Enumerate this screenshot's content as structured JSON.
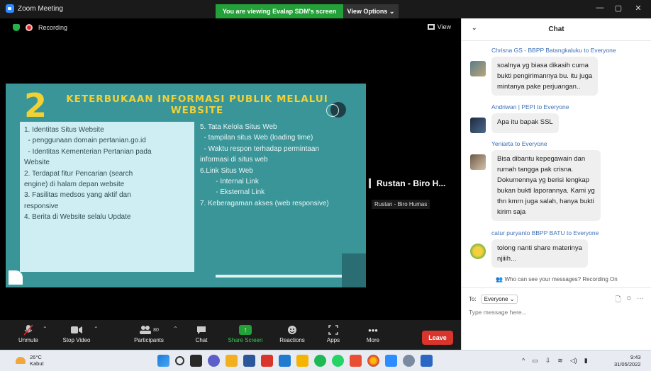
{
  "window": {
    "title": "Zoom Meeting",
    "viewing_banner": "You are viewing Evalap SDM's screen",
    "view_options": "View Options ⌄",
    "minimize": "—",
    "restore": "▢",
    "close": "✕"
  },
  "meeting": {
    "recording_label": "Recording",
    "view_label": "View",
    "speaker_name": "Rustan - Biro H...",
    "speaker_tag": "Rustan - Biro Humas"
  },
  "slide": {
    "number": "2",
    "title": "KETERBUKAAN INFORMASI PUBLIK MELALUI WEBSITE",
    "left_items": [
      "1. Identitas Situs Website",
      "  - penggunaan domain pertanian.go.id",
      "  - Identitas Kementerian Pertanian pada",
      "Website",
      "2. Terdapat fitur Pencarian (search",
      "engine) di halam depan website",
      "3. Fasilitas medsos yang aktif dan",
      "responsive",
      "4. Berita di Website selalu Update"
    ],
    "right_items": [
      "5. Tata Kelola Situs Web",
      "  - tampilan situs Web (loading time)",
      "  - Waktu respon terhadap permintaan",
      "informasi di situs web",
      "6.Link Situs Web",
      "        - Internal Link",
      "        - Eksternal Link",
      "7. Keberagaman akses (web responsive)"
    ]
  },
  "toolbar": {
    "unmute": "Unmute",
    "stop_video": "Stop Video",
    "participants": "Participants",
    "participants_count": "80",
    "chat": "Chat",
    "share_screen": "Share Screen",
    "reactions": "Reactions",
    "apps": "Apps",
    "more": "More",
    "leave": "Leave"
  },
  "chat": {
    "header": "Chat",
    "messages": [
      {
        "sender": "Chrisna GS - BBPP Batangkaluku to Everyone",
        "lines": [
          "soalnya yg biasa dikasih cuma",
          "bukti pengirimannya bu. itu juga",
          "mintanya pake perjuangan.."
        ]
      },
      {
        "sender": "Andriwan | PEPI to Everyone",
        "lines": [
          "Apa itu bapak SSL"
        ]
      },
      {
        "sender": "Yeniarta to Everyone",
        "lines": [
          "Bisa dibantu kepegawain dan",
          "rumah tangga pak crisna.",
          "Dokumennya yg berisi lengkap",
          "bukan bukti laporannya. Kami yg",
          "thn kmrn juga salah, hanya bukti",
          "kirim saja"
        ]
      },
      {
        "sender": "catur puryanto BBPP BATU to Everyone",
        "lines": [
          "tolong nanti share materinya",
          "njiiih..."
        ]
      }
    ],
    "privacy_note": "Who can see your messages? Recording On",
    "to_label": "To:",
    "to_value": "Everyone ⌄",
    "input_placeholder": "Type message here..."
  },
  "taskbar": {
    "temp": "26°C",
    "weather": "Kabut",
    "time": "9:43",
    "date": "31/05/2022"
  },
  "colors": {
    "share_green": "#23a038",
    "leave_red": "#d9352c",
    "slide_teal": "#3a9598",
    "slide_yellow": "#f2d133",
    "chat_sender_blue": "#3b6fb6"
  }
}
